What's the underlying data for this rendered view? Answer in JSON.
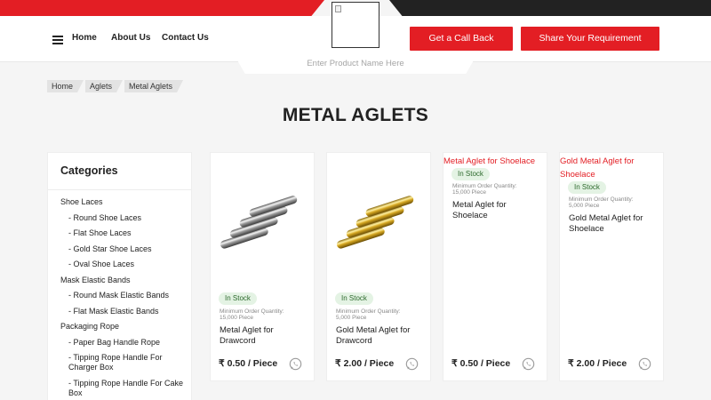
{
  "header": {
    "nav": [
      "Home",
      "About Us",
      "Contact Us"
    ],
    "call_button": "Get a Call Back",
    "share_button": "Share Your Requirement",
    "search_placeholder": "Enter Product Name Here"
  },
  "breadcrumb": [
    "Home",
    "Aglets",
    "Metal Aglets"
  ],
  "page_title": "METAL AGLETS",
  "sidebar": {
    "title": "Categories",
    "items": [
      {
        "label": "Shoe Laces",
        "sub": false
      },
      {
        "label": "- Round Shoe Laces",
        "sub": true
      },
      {
        "label": "- Flat Shoe Laces",
        "sub": true
      },
      {
        "label": "- Gold Star Shoe Laces",
        "sub": true
      },
      {
        "label": "- Oval Shoe Laces",
        "sub": true
      },
      {
        "label": "Mask Elastic Bands",
        "sub": false
      },
      {
        "label": "- Round Mask Elastic Bands",
        "sub": true
      },
      {
        "label": "- Flat Mask Elastic Bands",
        "sub": true
      },
      {
        "label": "Packaging Rope",
        "sub": false
      },
      {
        "label": "- Paper Bag Handle Rope",
        "sub": true
      },
      {
        "label": "- Tipping Rope Handle For Charger Box",
        "sub": true
      },
      {
        "label": "- Tipping Rope Handle For Cake Box",
        "sub": true
      }
    ]
  },
  "products": [
    {
      "top_title": "",
      "stock": "In Stock",
      "moq_label": "Minimum Order Quantity:",
      "moq_value": "15,000 Piece",
      "name": "Metal Aglet for Drawcord",
      "price": "₹ 0.50 / Piece",
      "image": "silver-aglets"
    },
    {
      "top_title": "",
      "stock": "In Stock",
      "moq_label": "Minimum Order Quantity:",
      "moq_value": "5,000 Piece",
      "name": "Gold Metal Aglet for Drawcord",
      "price": "₹ 2.00 / Piece",
      "image": "gold-aglets"
    },
    {
      "top_title": "Metal Aglet for Shoelace",
      "stock": "In Stock",
      "moq_label": "Minimum Order Quantity:",
      "moq_value": "15,000 Piece",
      "name": "Metal Aglet for Shoelace",
      "price": "₹ 0.50 / Piece",
      "image": "broken-image"
    },
    {
      "top_title": "Gold Metal Aglet for Shoelace",
      "stock": "In Stock",
      "moq_label": "Minimum Order Quantity:",
      "moq_value": "5,000 Piece",
      "name": "Gold Metal Aglet for Shoelace",
      "price": "₹ 2.00 / Piece",
      "image": "broken-image"
    }
  ],
  "colors": {
    "brand": "#e31e24",
    "dark": "#222222",
    "in_stock_bg": "#e4f3e4"
  },
  "icons": {
    "menu": "menu-icon",
    "whatsapp": "whatsapp-icon",
    "logo": "broken-image-icon"
  }
}
